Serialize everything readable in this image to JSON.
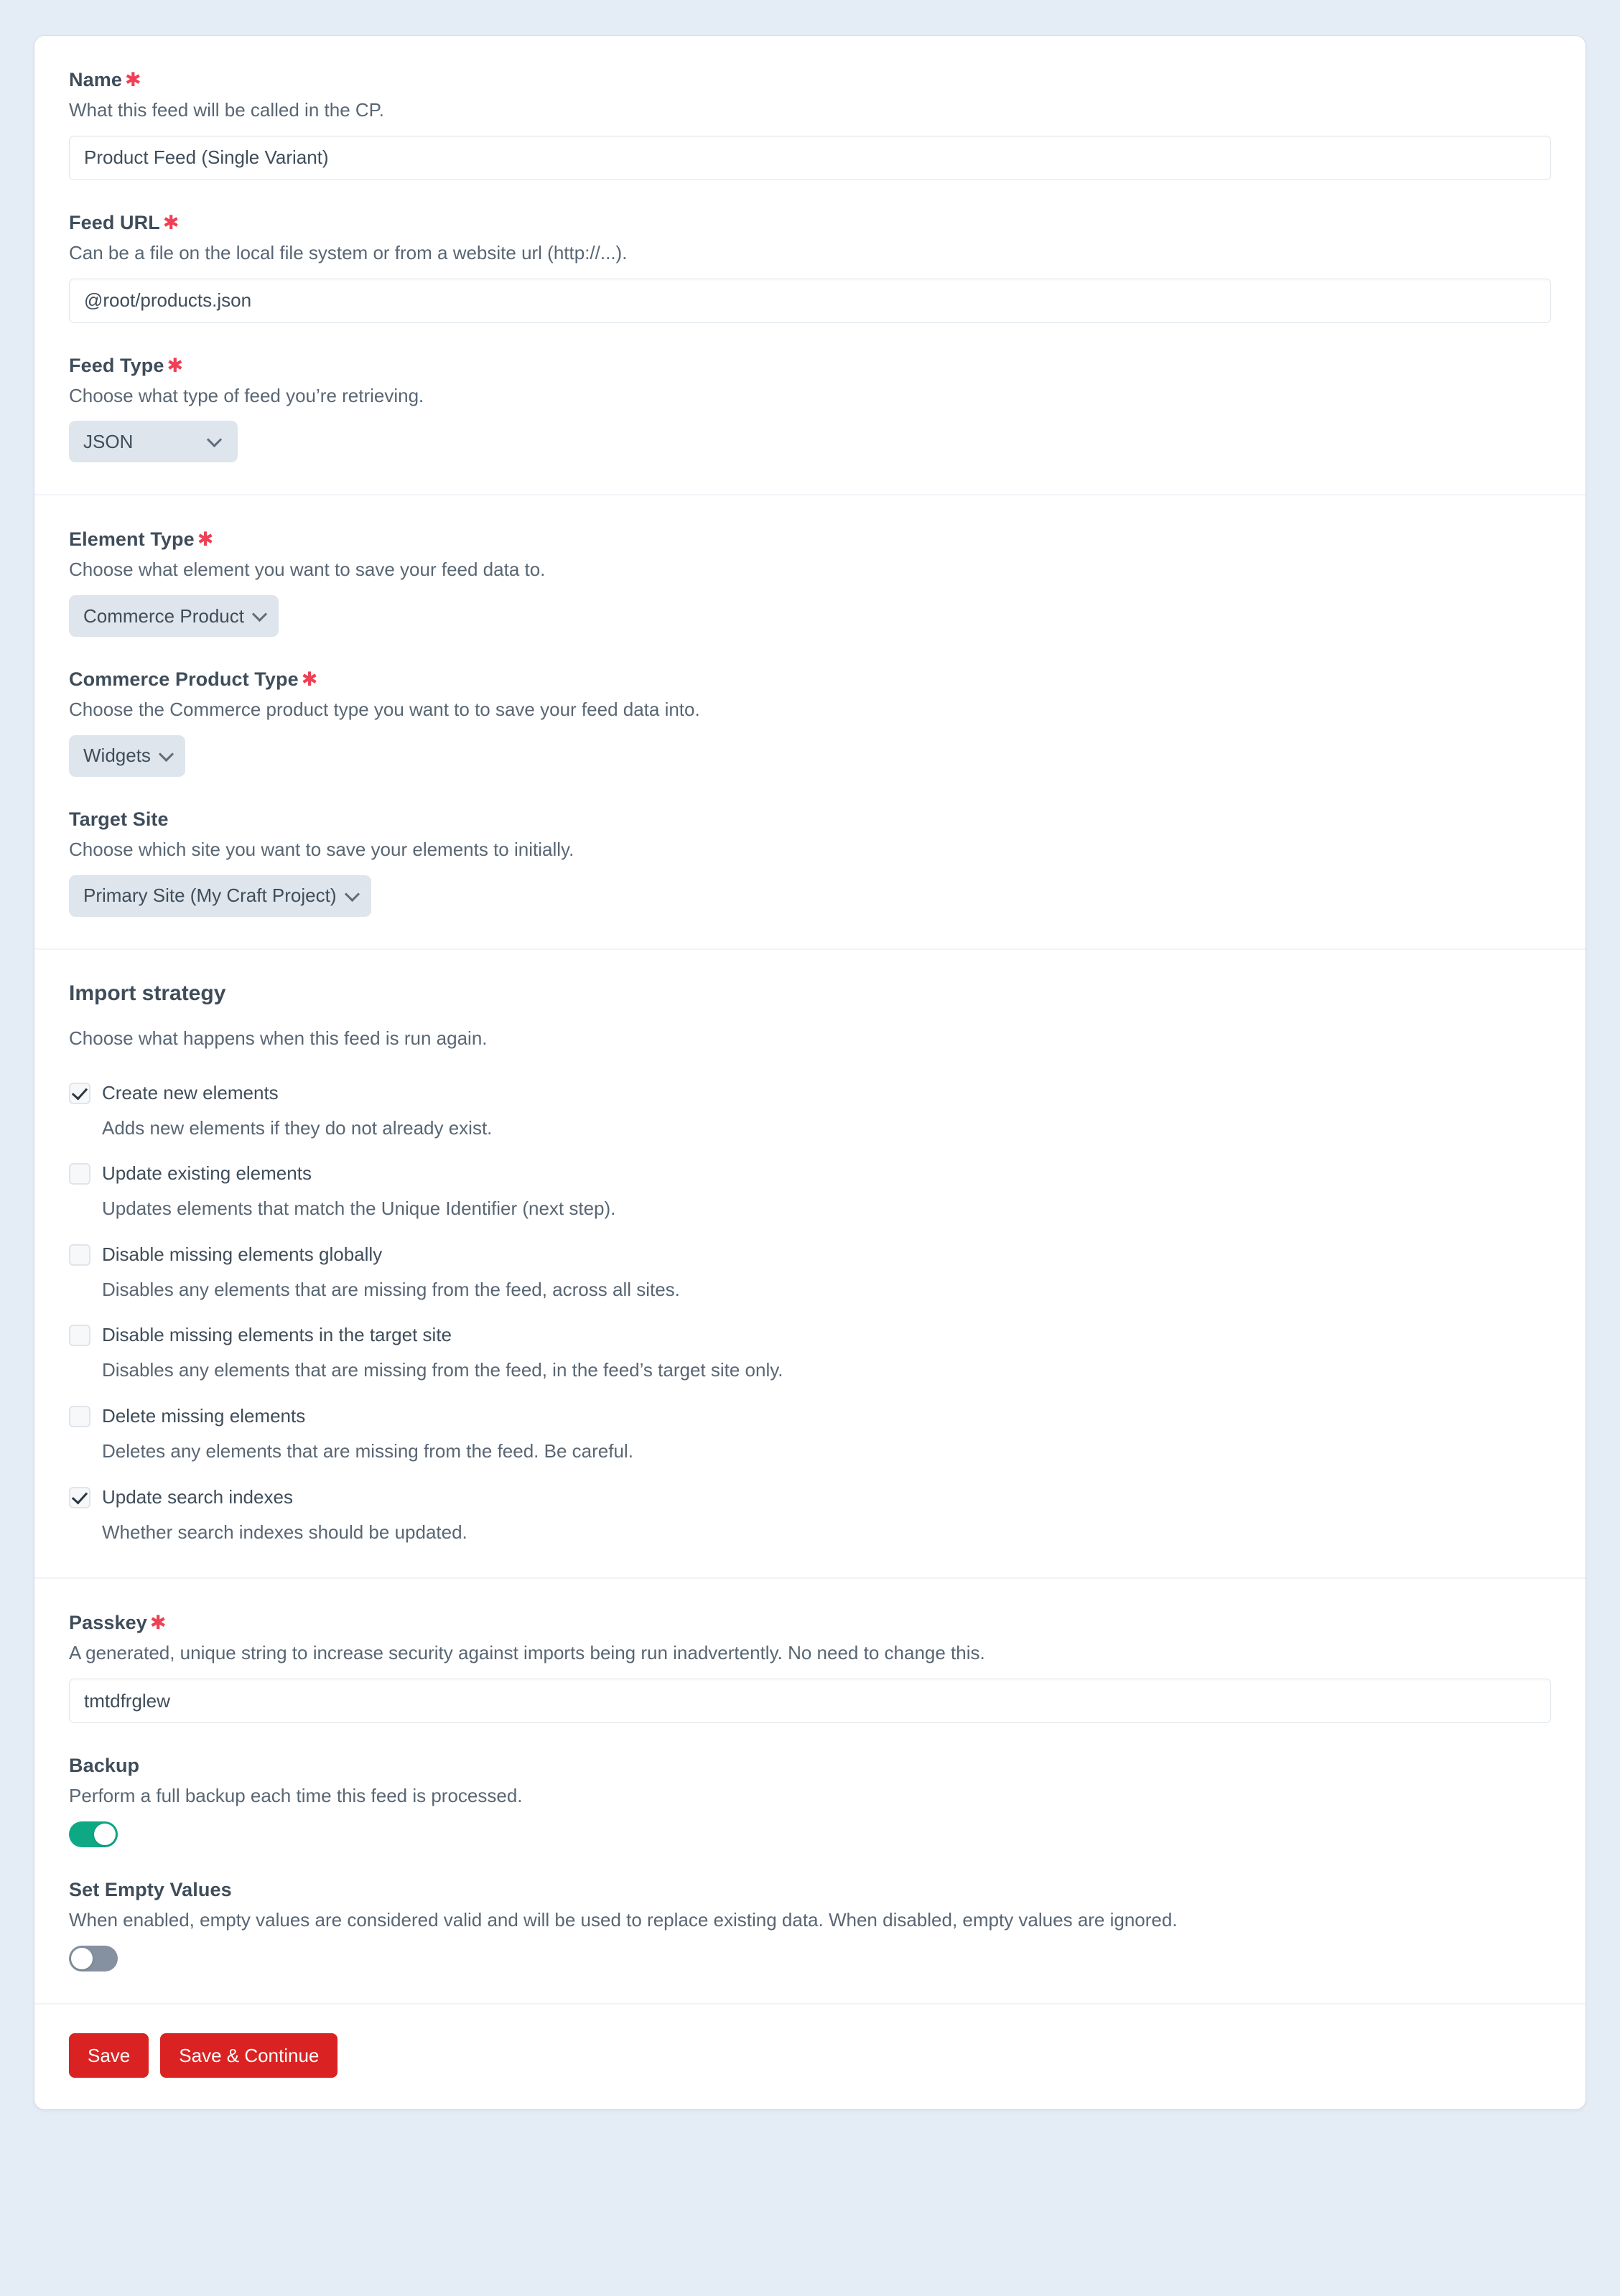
{
  "colors": {
    "page_background": "#e4ecf6",
    "card_background": "#ffffff",
    "required_asterisk": "#ef4056",
    "label_text": "#3f4d5a",
    "instruction_text": "#596673",
    "select_pill": "#dfe5ec",
    "toggle_on": "#0ea885",
    "toggle_off": "#8591a0",
    "button_primary": "#da2222"
  },
  "sections": {
    "feed": {
      "name": {
        "label": "Name",
        "required": "✱",
        "instructions": "What this feed will be called in the CP.",
        "value": "Product Feed (Single Variant)",
        "placeholder": ""
      },
      "feed_url": {
        "label": "Feed URL",
        "required": "✱",
        "instructions": "Can be a file on the local file system or from a website url (http://...).",
        "value": "@root/products.json",
        "placeholder": ""
      },
      "feed_type": {
        "label": "Feed Type",
        "required": "✱",
        "instructions": "Choose what type of feed you’re retrieving.",
        "value": "JSON",
        "options": [
          "JSON"
        ]
      }
    },
    "element": {
      "element_type": {
        "label": "Element Type",
        "required": "✱",
        "instructions": "Choose what element you want to save your feed data to.",
        "value": "Commerce Product",
        "options": [
          "Commerce Product"
        ]
      },
      "commerce_product_type": {
        "label": "Commerce Product Type",
        "required": "✱",
        "instructions": "Choose the Commerce product type you want to to save your feed data into.",
        "value": "Widgets",
        "options": [
          "Widgets"
        ]
      },
      "target_site": {
        "label": "Target Site",
        "required": "",
        "instructions": "Choose which site you want to save your elements to initially.",
        "value": "Primary Site (My Craft Project)",
        "options": [
          "Primary Site (My Craft Project)"
        ]
      }
    },
    "import_strategy": {
      "heading": "Import strategy",
      "subtitle": "Choose what happens when this feed is run again.",
      "checkboxes": [
        {
          "label": "Create new elements",
          "description": "Adds new elements if they do not already exist.",
          "checked": true
        },
        {
          "label": "Update existing elements",
          "description": "Updates elements that match the Unique Identifier (next step).",
          "checked": false
        },
        {
          "label": "Disable missing elements globally",
          "description": "Disables any elements that are missing from the feed, across all sites.",
          "checked": false
        },
        {
          "label": "Disable missing elements in the target site",
          "description": "Disables any elements that are missing from the feed, in the feed’s target site only.",
          "checked": false
        },
        {
          "label": "Delete missing elements",
          "description": "Deletes any elements that are missing from the feed. Be careful.",
          "checked": false
        },
        {
          "label": "Update search indexes",
          "description": "Whether search indexes should be updated.",
          "checked": true
        }
      ]
    },
    "security": {
      "passkey": {
        "label": "Passkey",
        "required": "✱",
        "instructions": "A generated, unique string to increase security against imports being run inadvertently. No need to change this.",
        "value": "tmtdfrglew",
        "placeholder": ""
      },
      "backup": {
        "label": "Backup",
        "instructions": "Perform a full backup each time this feed is processed.",
        "enabled": true,
        "state_text": "on"
      },
      "set_empty_values": {
        "label": "Set Empty Values",
        "instructions": "When enabled, empty values are considered valid and will be used to replace existing data. When disabled, empty values are ignored.",
        "enabled": false,
        "state_text": "off"
      }
    },
    "footer": {
      "save_label": "Save",
      "save_continue_label": "Save & Continue"
    }
  }
}
